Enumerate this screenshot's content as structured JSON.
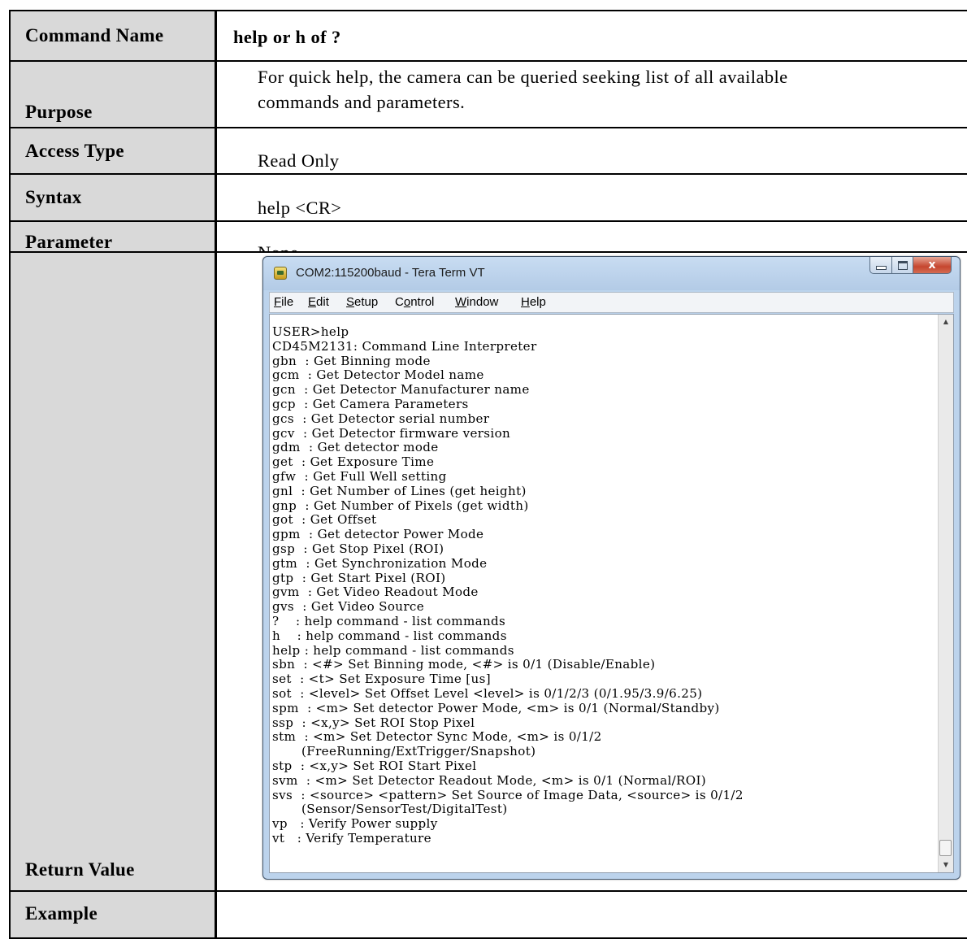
{
  "rows": [
    {
      "label": "Command Name",
      "value": "help or h of ?"
    },
    {
      "label": "Purpose",
      "value_lines": [
        "For quick help, the camera can be queried seeking list of all available",
        "commands and parameters."
      ]
    },
    {
      "label": "Access Type",
      "value": "Read Only"
    },
    {
      "label": "Syntax",
      "value": "help <CR>"
    },
    {
      "label": "Parameter",
      "value": "None"
    },
    {
      "label": "Return Value"
    },
    {
      "label": "Example"
    }
  ],
  "window": {
    "title": "COM2:115200baud - Tera Term VT",
    "close_glyph": "x",
    "menu": [
      {
        "pre": "",
        "key": "F",
        "post": "ile"
      },
      {
        "pre": "",
        "key": "E",
        "post": "dit"
      },
      {
        "pre": "",
        "key": "S",
        "post": "etup"
      },
      {
        "pre": "C",
        "key": "o",
        "post": "ntrol"
      },
      {
        "pre": "",
        "key": "W",
        "post": "indow"
      },
      {
        "pre": "",
        "key": "H",
        "post": "elp"
      }
    ]
  },
  "terminal": {
    "lines": [
      "USER>help",
      "CD45M2131: Command Line Interpreter",
      "gbn  : Get Binning mode",
      "gcm  : Get Detector Model name",
      "gcn  : Get Detector Manufacturer name",
      "gcp  : Get Camera Parameters",
      "gcs  : Get Detector serial number",
      "gcv  : Get Detector firmware version",
      "gdm  : Get detector mode",
      "get  : Get Exposure Time",
      "gfw  : Get Full Well setting",
      "gnl  : Get Number of Lines (get height)",
      "gnp  : Get Number of Pixels (get width)",
      "got  : Get Offset",
      "gpm  : Get detector Power Mode",
      "gsp  : Get Stop Pixel (ROI)",
      "gtm  : Get Synchronization Mode",
      "gtp  : Get Start Pixel (ROI)",
      "gvm  : Get Video Readout Mode",
      "gvs  : Get Video Source",
      "?    : help command - list commands",
      "h    : help command - list commands",
      "help : help command - list commands",
      "sbn  : <#> Set Binning mode, <#> is 0/1 (Disable/Enable)",
      "set  : <t> Set Exposure Time [us]",
      "sot  : <level> Set Offset Level <level> is 0/1/2/3 (0/1.95/3.9/6.25)",
      "spm  : <m> Set detector Power Mode, <m> is 0/1 (Normal/Standby)",
      "ssp  : <x,y> Set ROI Stop Pixel",
      "stm  : <m> Set Detector Sync Mode, <m> is 0/1/2",
      "       (FreeRunning/ExtTrigger/Snapshot)",
      "stp  : <x,y> Set ROI Start Pixel",
      "svm  : <m> Set Detector Readout Mode, <m> is 0/1 (Normal/ROI)",
      "svs  : <source> <pattern> Set Source of Image Data, <source> is 0/1/2",
      "       (Sensor/SensorTest/DigitalTest)",
      "vp   : Verify Power supply",
      "vt   : Verify Temperature",
      "",
      "",
      ""
    ],
    "prompt": "USER>"
  }
}
